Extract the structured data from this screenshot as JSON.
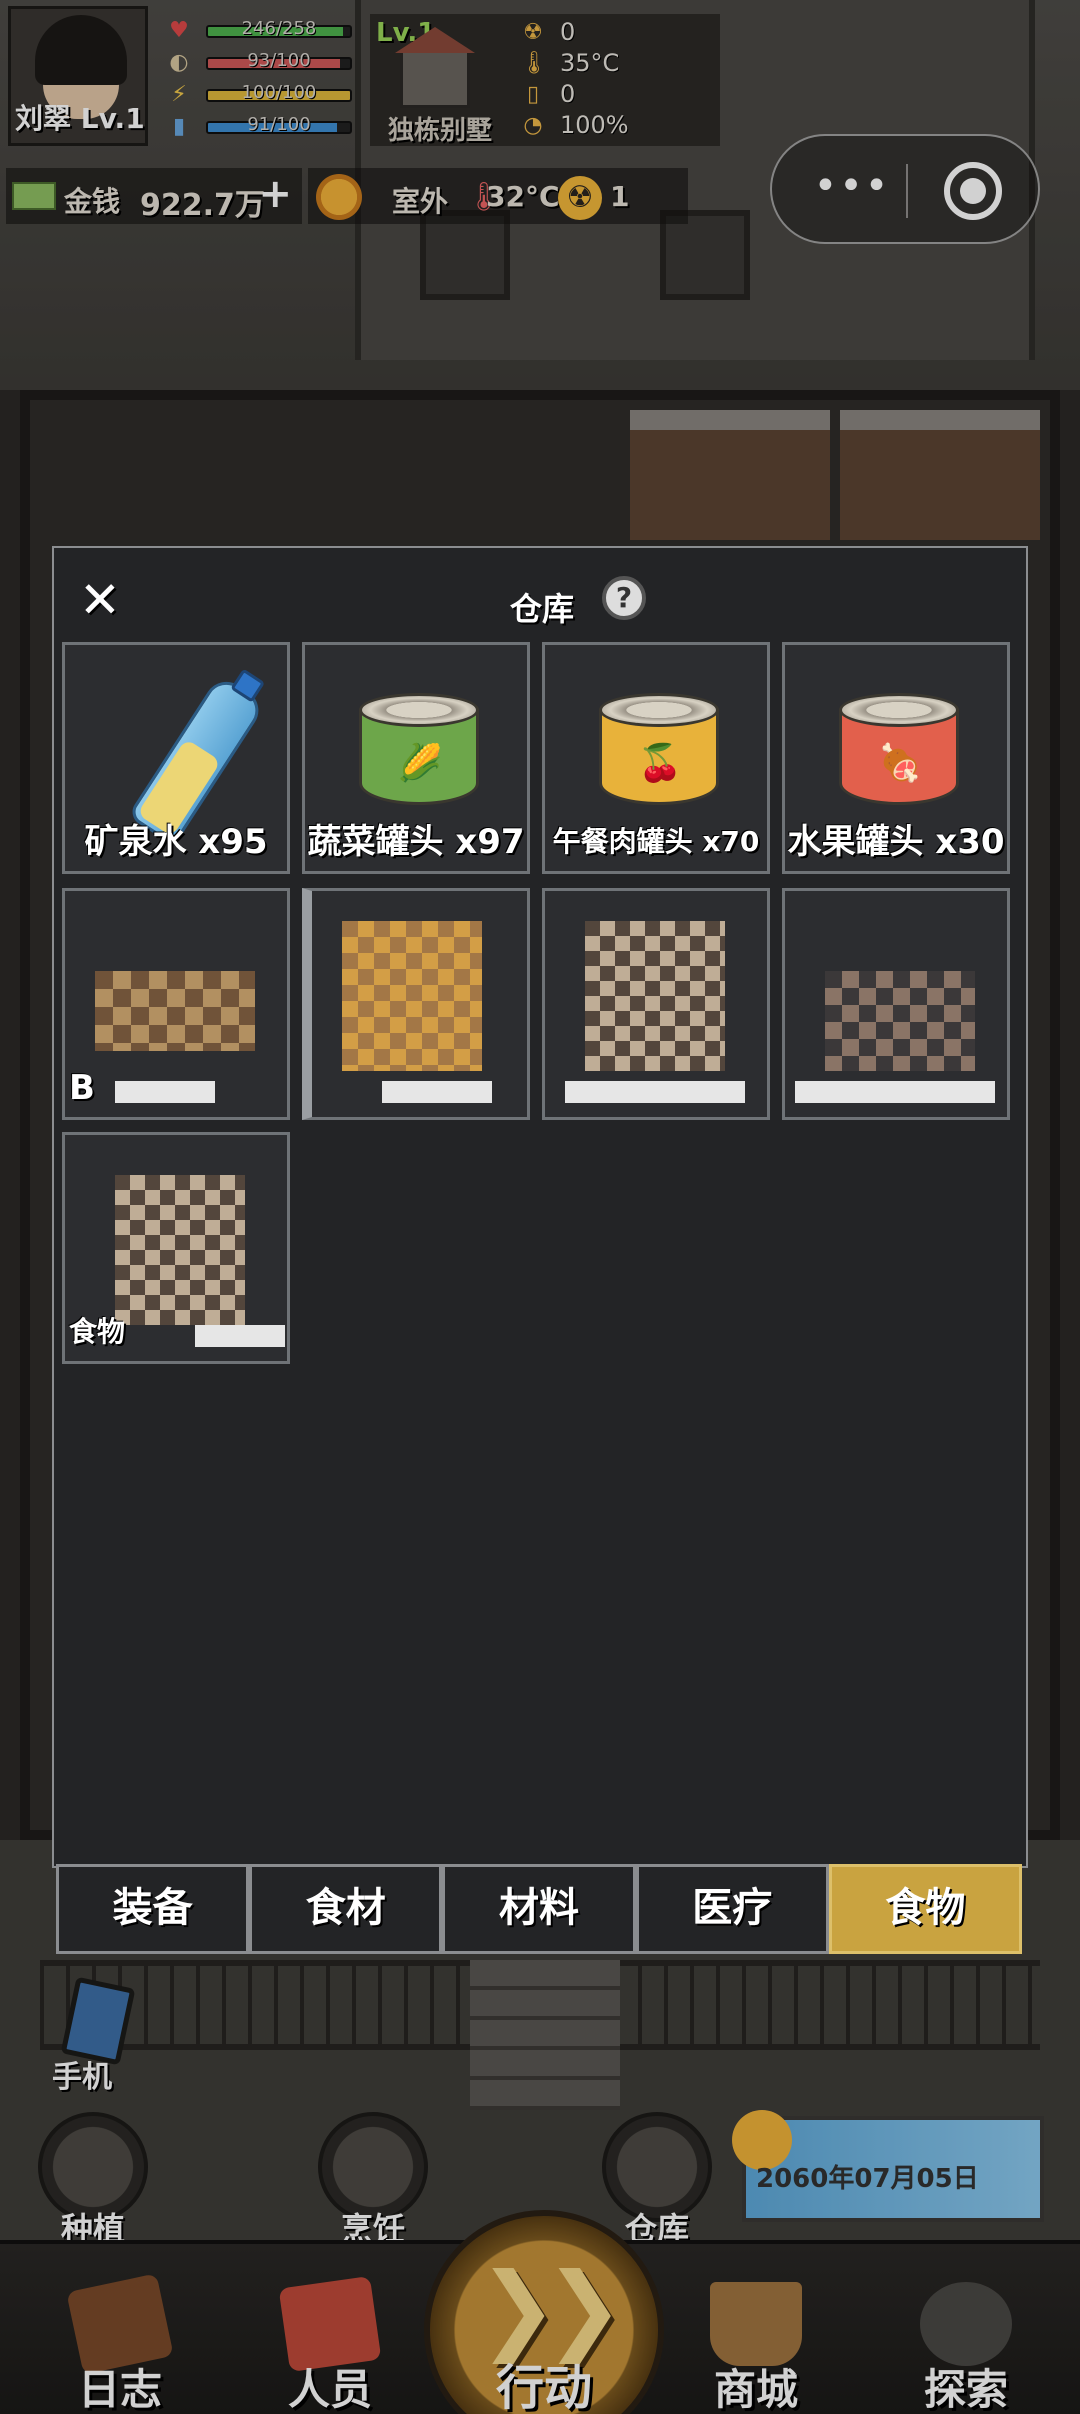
{
  "player": {
    "name_level": "刘翠 Lv.1",
    "stats": [
      {
        "icon": "heart-icon",
        "glyph": "♥",
        "color": "#e04a4a",
        "value": "246/258",
        "fill": 0.95,
        "bar_color": "#4fb34f"
      },
      {
        "icon": "stomach-icon",
        "glyph": "◐",
        "color": "#d8c7a0",
        "value": "93/100",
        "fill": 0.93,
        "bar_color": "#d25a5a"
      },
      {
        "icon": "lightning-icon",
        "glyph": "⚡",
        "color": "#f2c94c",
        "value": "100/100",
        "fill": 1.0,
        "bar_color": "#e0b93c"
      },
      {
        "icon": "water-icon",
        "glyph": "▮",
        "color": "#6aa8e0",
        "value": "91/100",
        "fill": 0.91,
        "bar_color": "#3f8fd4"
      }
    ]
  },
  "home": {
    "level": "Lv.1",
    "name": "独栋别墅",
    "env": [
      {
        "icon": "radiation-icon",
        "glyph": "☢",
        "value": "0"
      },
      {
        "icon": "thermometer-icon",
        "glyph": "🌡",
        "value": "35°C"
      },
      {
        "icon": "battery-icon",
        "glyph": "▯",
        "value": "0"
      },
      {
        "icon": "durability-icon",
        "glyph": "◔",
        "value": "100%"
      }
    ]
  },
  "money": {
    "label": "金钱",
    "amount": "922.7万",
    "add": "+"
  },
  "weather": {
    "label": "室外",
    "temperature": "32°C",
    "radiation": "1",
    "thermo_glyph": "🌡",
    "radiation_glyph": "☢"
  },
  "capsule": {
    "more_glyph": "•••"
  },
  "warehouse": {
    "title": "仓库",
    "close_glyph": "✕",
    "help_glyph": "?",
    "items": [
      {
        "label": "矿泉水 x95",
        "kind": "bottle"
      },
      {
        "label": "蔬菜罐头 x97",
        "kind": "can",
        "body_color": "#6da64a",
        "emblem": "🌽"
      },
      {
        "label": "午餐肉罐头 x70",
        "kind": "can",
        "body_color": "#e8b23a",
        "emblem": "🍒"
      },
      {
        "label": "水果罐头 x30",
        "kind": "can",
        "body_color": "#e2604c",
        "emblem": "🍖"
      }
    ],
    "partial_labels": {
      "row2_first": "B",
      "row3_first": "食物"
    },
    "tabs": [
      {
        "label": "装备",
        "active": false
      },
      {
        "label": "食材",
        "active": false
      },
      {
        "label": "材料",
        "active": false
      },
      {
        "label": "医疗",
        "active": false
      },
      {
        "label": "食物",
        "active": true
      }
    ]
  },
  "shortcuts": {
    "phone": "手机",
    "planting": "种植",
    "cooking": "烹饪",
    "warehouse": "仓库"
  },
  "date": "2060年07月05日",
  "nav": {
    "log": "日志",
    "people": "人员",
    "action": "行动",
    "action_glyph": "❯❯",
    "shop": "商城",
    "explore": "探索"
  }
}
